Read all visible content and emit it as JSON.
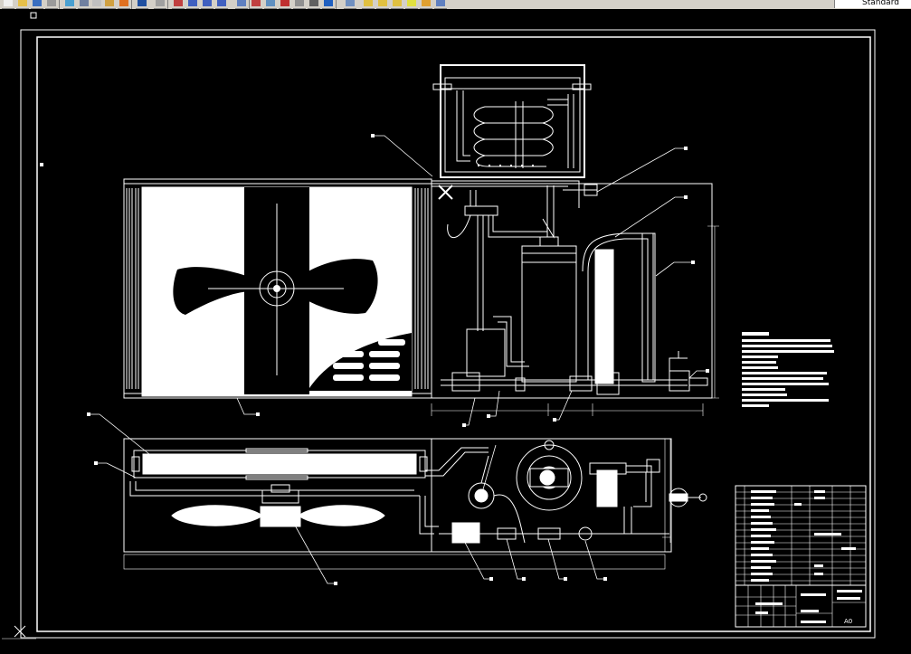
{
  "toolbar": {
    "style_combo_value": "Standard",
    "buttons": [
      {
        "name": "new-icon",
        "color": "#f0f0f0"
      },
      {
        "name": "open-icon",
        "color": "#e6c04a"
      },
      {
        "name": "save-icon",
        "color": "#3a6fc0"
      },
      {
        "name": "print-icon",
        "color": "#9a9a9a"
      },
      {
        "name": "preview-icon",
        "color": "#4aa0d0"
      },
      {
        "name": "cut-icon",
        "color": "#7080a0"
      },
      {
        "name": "copy-icon",
        "color": "#c0c0c0"
      },
      {
        "name": "paste-icon",
        "color": "#d0a040"
      },
      {
        "name": "match-properties-icon",
        "color": "#e07020"
      },
      {
        "name": "undo-icon",
        "color": "#2050a0"
      },
      {
        "name": "redo-icon",
        "color": "#a0a0a0"
      },
      {
        "name": "pan-icon",
        "color": "#c04040"
      },
      {
        "name": "zoom-realtime-icon",
        "color": "#4060c0"
      },
      {
        "name": "zoom-window-icon",
        "color": "#4060c0"
      },
      {
        "name": "zoom-previous-icon",
        "color": "#4060c0"
      },
      {
        "name": "properties-icon",
        "color": "#6080c0"
      },
      {
        "name": "design-center-icon",
        "color": "#c04040"
      },
      {
        "name": "tool-palettes-icon",
        "color": "#6090c0"
      },
      {
        "name": "sheet-set-icon",
        "color": "#c03030"
      },
      {
        "name": "markup-icon",
        "color": "#909090"
      },
      {
        "name": "calculator-icon",
        "color": "#606060"
      },
      {
        "name": "help-icon",
        "color": "#2060c0"
      },
      {
        "name": "layer-manager-icon",
        "color": "#7090c0"
      },
      {
        "name": "layer-state-icon",
        "color": "#e0c040"
      },
      {
        "name": "layer-freeze-icon",
        "color": "#e0c040"
      },
      {
        "name": "layer-lock-icon",
        "color": "#e0c040"
      },
      {
        "name": "layer-color-icon",
        "color": "#e0e040"
      },
      {
        "name": "make-current-icon",
        "color": "#e0a030"
      },
      {
        "name": "layer-previous-icon",
        "color": "#6080c0"
      }
    ]
  },
  "drawing": {
    "background": "#000000",
    "line_color": "#ffffff",
    "text_color": "#ffffff",
    "title_block": {
      "sheet_size": "A0"
    }
  }
}
